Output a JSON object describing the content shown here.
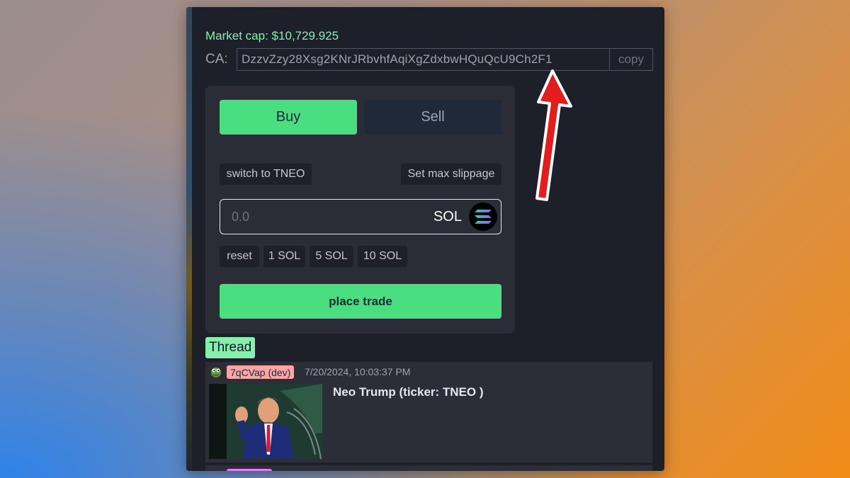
{
  "market_cap": "Market cap: $10,729.925",
  "contract": {
    "label": "CA:",
    "address": "DzzvZzy28Xsg2KNrJRbvhfAqiXgZdxbwHQuQcU9Ch2F1",
    "copy_label": "copy"
  },
  "trade": {
    "buy_label": "Buy",
    "sell_label": "Sell",
    "switch_label": "switch to TNEO",
    "slippage_label": "Set max slippage",
    "amount_placeholder": "0.0",
    "unit": "SOL",
    "quick_amounts": [
      "reset",
      "1 SOL",
      "5 SOL",
      "10 SOL"
    ],
    "place_trade_label": "place trade"
  },
  "thread": {
    "label": "Thread",
    "posts": [
      {
        "user": "7qCVap (dev)",
        "date": "7/20/2024, 10:03:37 PM",
        "title": "Neo Trump (ticker: TNEO )"
      }
    ]
  },
  "colors": {
    "accent_green": "#4ade80",
    "mcap_green": "#86efac",
    "dev_badge": "#fca5a5",
    "arrow_red": "#e11d1d"
  }
}
